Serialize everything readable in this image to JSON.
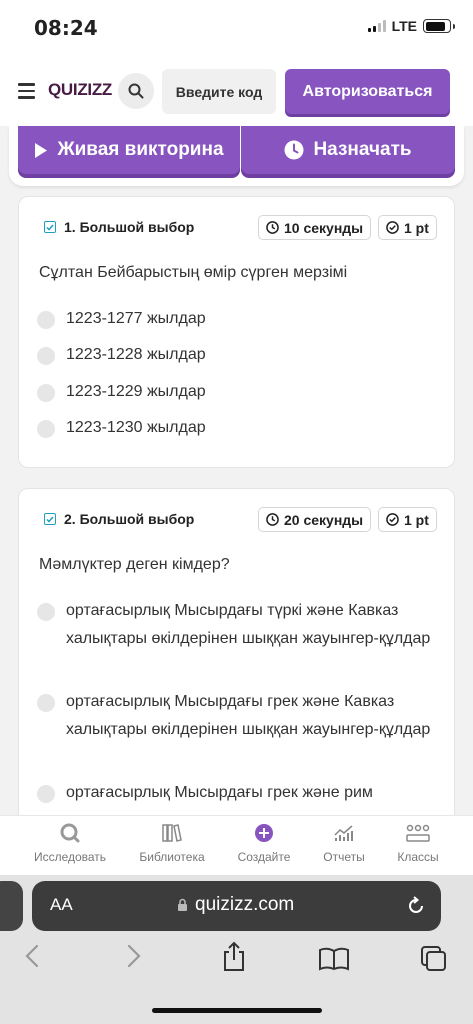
{
  "status_bar": {
    "time": "08:24",
    "network": "LTE",
    "battery_level": 0.85
  },
  "header": {
    "logo": "QUIZIZZ",
    "code_button": "Введите код",
    "login_button": "Авторизоваться"
  },
  "actions": {
    "live_quiz": "Живая викторина",
    "assign": "Назначать"
  },
  "questions": [
    {
      "type": "1. Большой выбор",
      "time": "10 секунды",
      "points": "1 pt",
      "text": "Сұлтан Бейбарыстың өмір сүрген мерзімі",
      "options": [
        "1223-1277 жылдар",
        "1223-1228 жылдар",
        "1223-1229 жылдар",
        "1223-1230 жылдар"
      ]
    },
    {
      "type": "2. Большой выбор",
      "time": "20 секунды",
      "points": "1 pt",
      "text": "Мәмлүктер деген кімдер?",
      "options": [
        "ортағасырлық Мысырдағы түркі және Кавказ халықтары өкілдерінен шыққан жауынгер-құлдар",
        "ортағасырлық Мысырдағы грек және Кавказ халықтары өкілдерінен шыққан жауынгер-құлдар",
        "ортағасырлық Мысырдағы грек және рим"
      ]
    }
  ],
  "bottom_nav": {
    "items": [
      "Исследовать",
      "Библиотека",
      "Создайте",
      "Отчеты",
      "Классы"
    ]
  },
  "browser": {
    "aa_label": "AA",
    "url": "quizizz.com"
  },
  "colors": {
    "brand_purple": "#8854c0",
    "logo": "#461a42",
    "checkbox": "#1e9fc0"
  }
}
